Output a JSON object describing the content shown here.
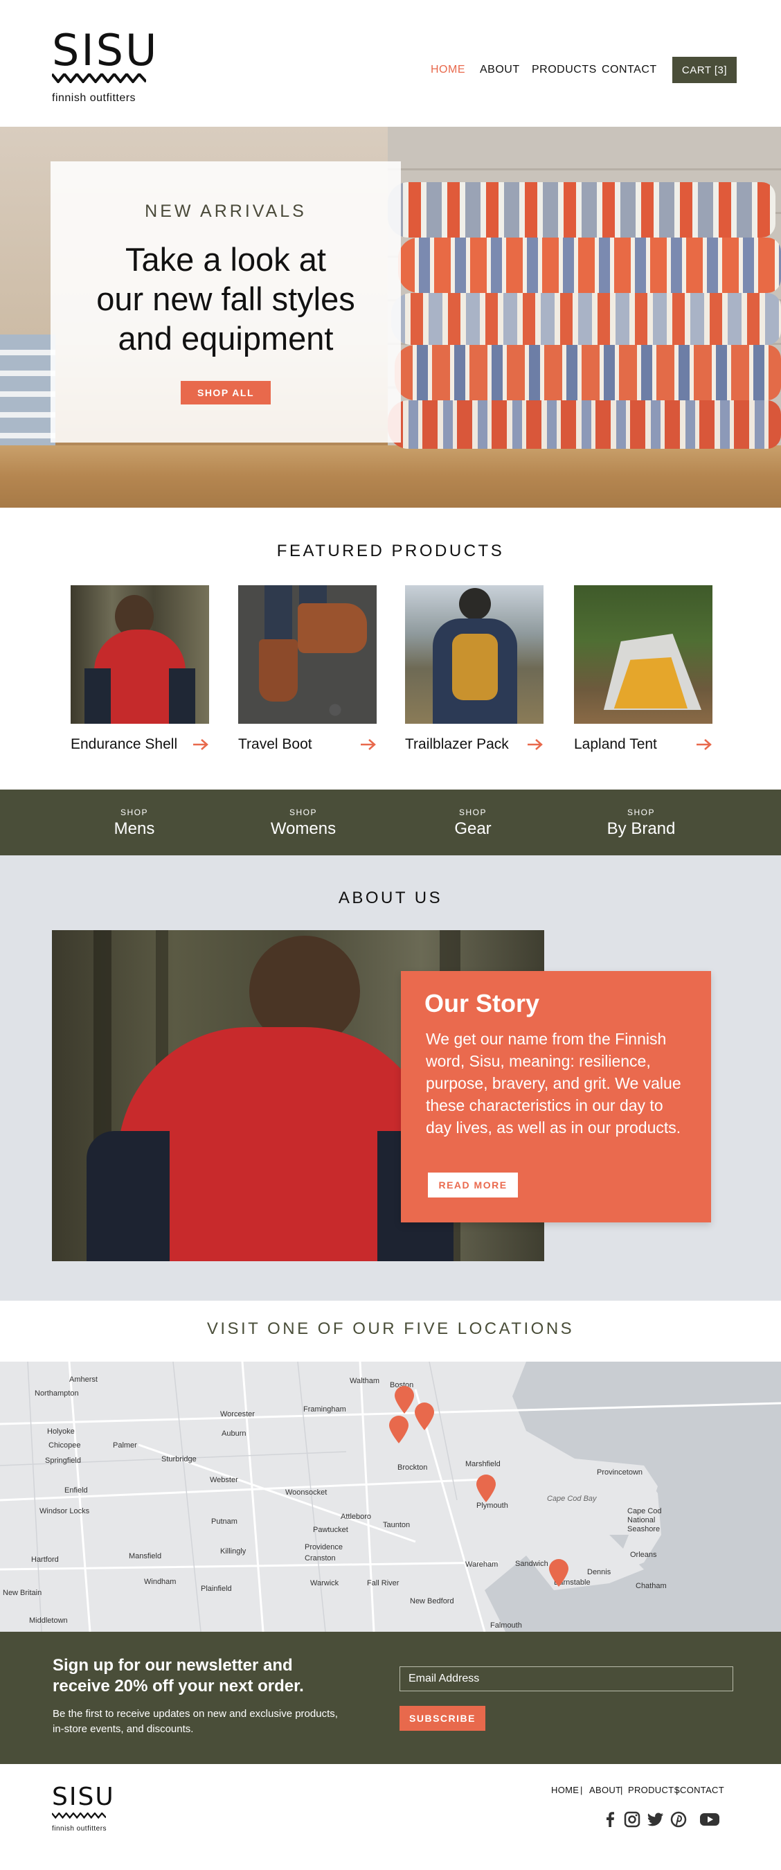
{
  "brand": {
    "name": "SISU",
    "tagline": "finnish outfitters"
  },
  "nav": {
    "home": "HOME",
    "about": "ABOUT",
    "products": "PRODUCTS",
    "contact": "CONTACT",
    "cart": "CART [3]"
  },
  "colors": {
    "accent": "#e8694c",
    "dark": "#4a4e39",
    "about_bg": "#dfe2e7"
  },
  "hero": {
    "kicker": "NEW ARRIVALS",
    "title_line1": "Take a look at",
    "title_line2": "our new fall styles",
    "title_line3": "and equipment",
    "button": "SHOP ALL"
  },
  "featured": {
    "title": "FEATURED PRODUCTS",
    "products": [
      {
        "name": "Endurance Shell",
        "icon": "arrow-right-icon"
      },
      {
        "name": "Travel Boot",
        "icon": "arrow-right-icon"
      },
      {
        "name": "Trailblazer Pack",
        "icon": "arrow-right-icon"
      },
      {
        "name": "Lapland Tent",
        "icon": "arrow-right-icon"
      }
    ]
  },
  "shop": {
    "items": [
      {
        "kicker": "SHOP",
        "label": "Mens"
      },
      {
        "kicker": "SHOP",
        "label": "Womens"
      },
      {
        "kicker": "SHOP",
        "label": "Gear"
      },
      {
        "kicker": "SHOP",
        "label": "By Brand"
      }
    ]
  },
  "about": {
    "title": "ABOUT US",
    "story_title": "Our Story",
    "story_body": "We get our name from the Finnish word, Sisu, meaning: resilience, purpose, bravery, and grit. We value these characteristics in our day to day lives, as well as in our products.",
    "button": "READ MORE"
  },
  "locations": {
    "title": "VISIT ONE OF OUR FIVE LOCATIONS",
    "map_labels": [
      "Amherst",
      "Northampton",
      "Holyoke",
      "Chicopee",
      "Springfield",
      "Palmer",
      "Sturbridge",
      "Enfield",
      "Windsor Locks",
      "Hartford",
      "New Britain",
      "Middletown",
      "Mansfield",
      "Windham",
      "Plainfield",
      "Worcester",
      "Auburn",
      "Webster",
      "Putnam",
      "Killingly",
      "Woonsocket",
      "Pawtucket",
      "Providence",
      "Cranston",
      "Warwick",
      "Attleboro",
      "Taunton",
      "Fall River",
      "New Bedford",
      "Waltham",
      "Boston",
      "Framingham",
      "Brockton",
      "Marshfield",
      "Plymouth",
      "Wareham",
      "Sandwich",
      "Barnstable",
      "Dennis",
      "Chatham",
      "Orleans",
      "Provincetown",
      "Cape Cod National Seashore",
      "Cape Cod Bay",
      "Falmouth"
    ]
  },
  "newsletter": {
    "title": "Sign up for our newsletter and receive 20% off your next order.",
    "body": "Be the first to receive updates on new and exclusive products, in-store events, and discounts.",
    "placeholder": "Email Address",
    "button": "SUBSCRIBE"
  },
  "footer": {
    "links": [
      "HOME",
      "ABOUT",
      "PRODUCTS",
      "CONTACT"
    ],
    "social": [
      "facebook-icon",
      "instagram-icon",
      "twitter-icon",
      "pinterest-icon",
      "youtube-icon"
    ]
  }
}
